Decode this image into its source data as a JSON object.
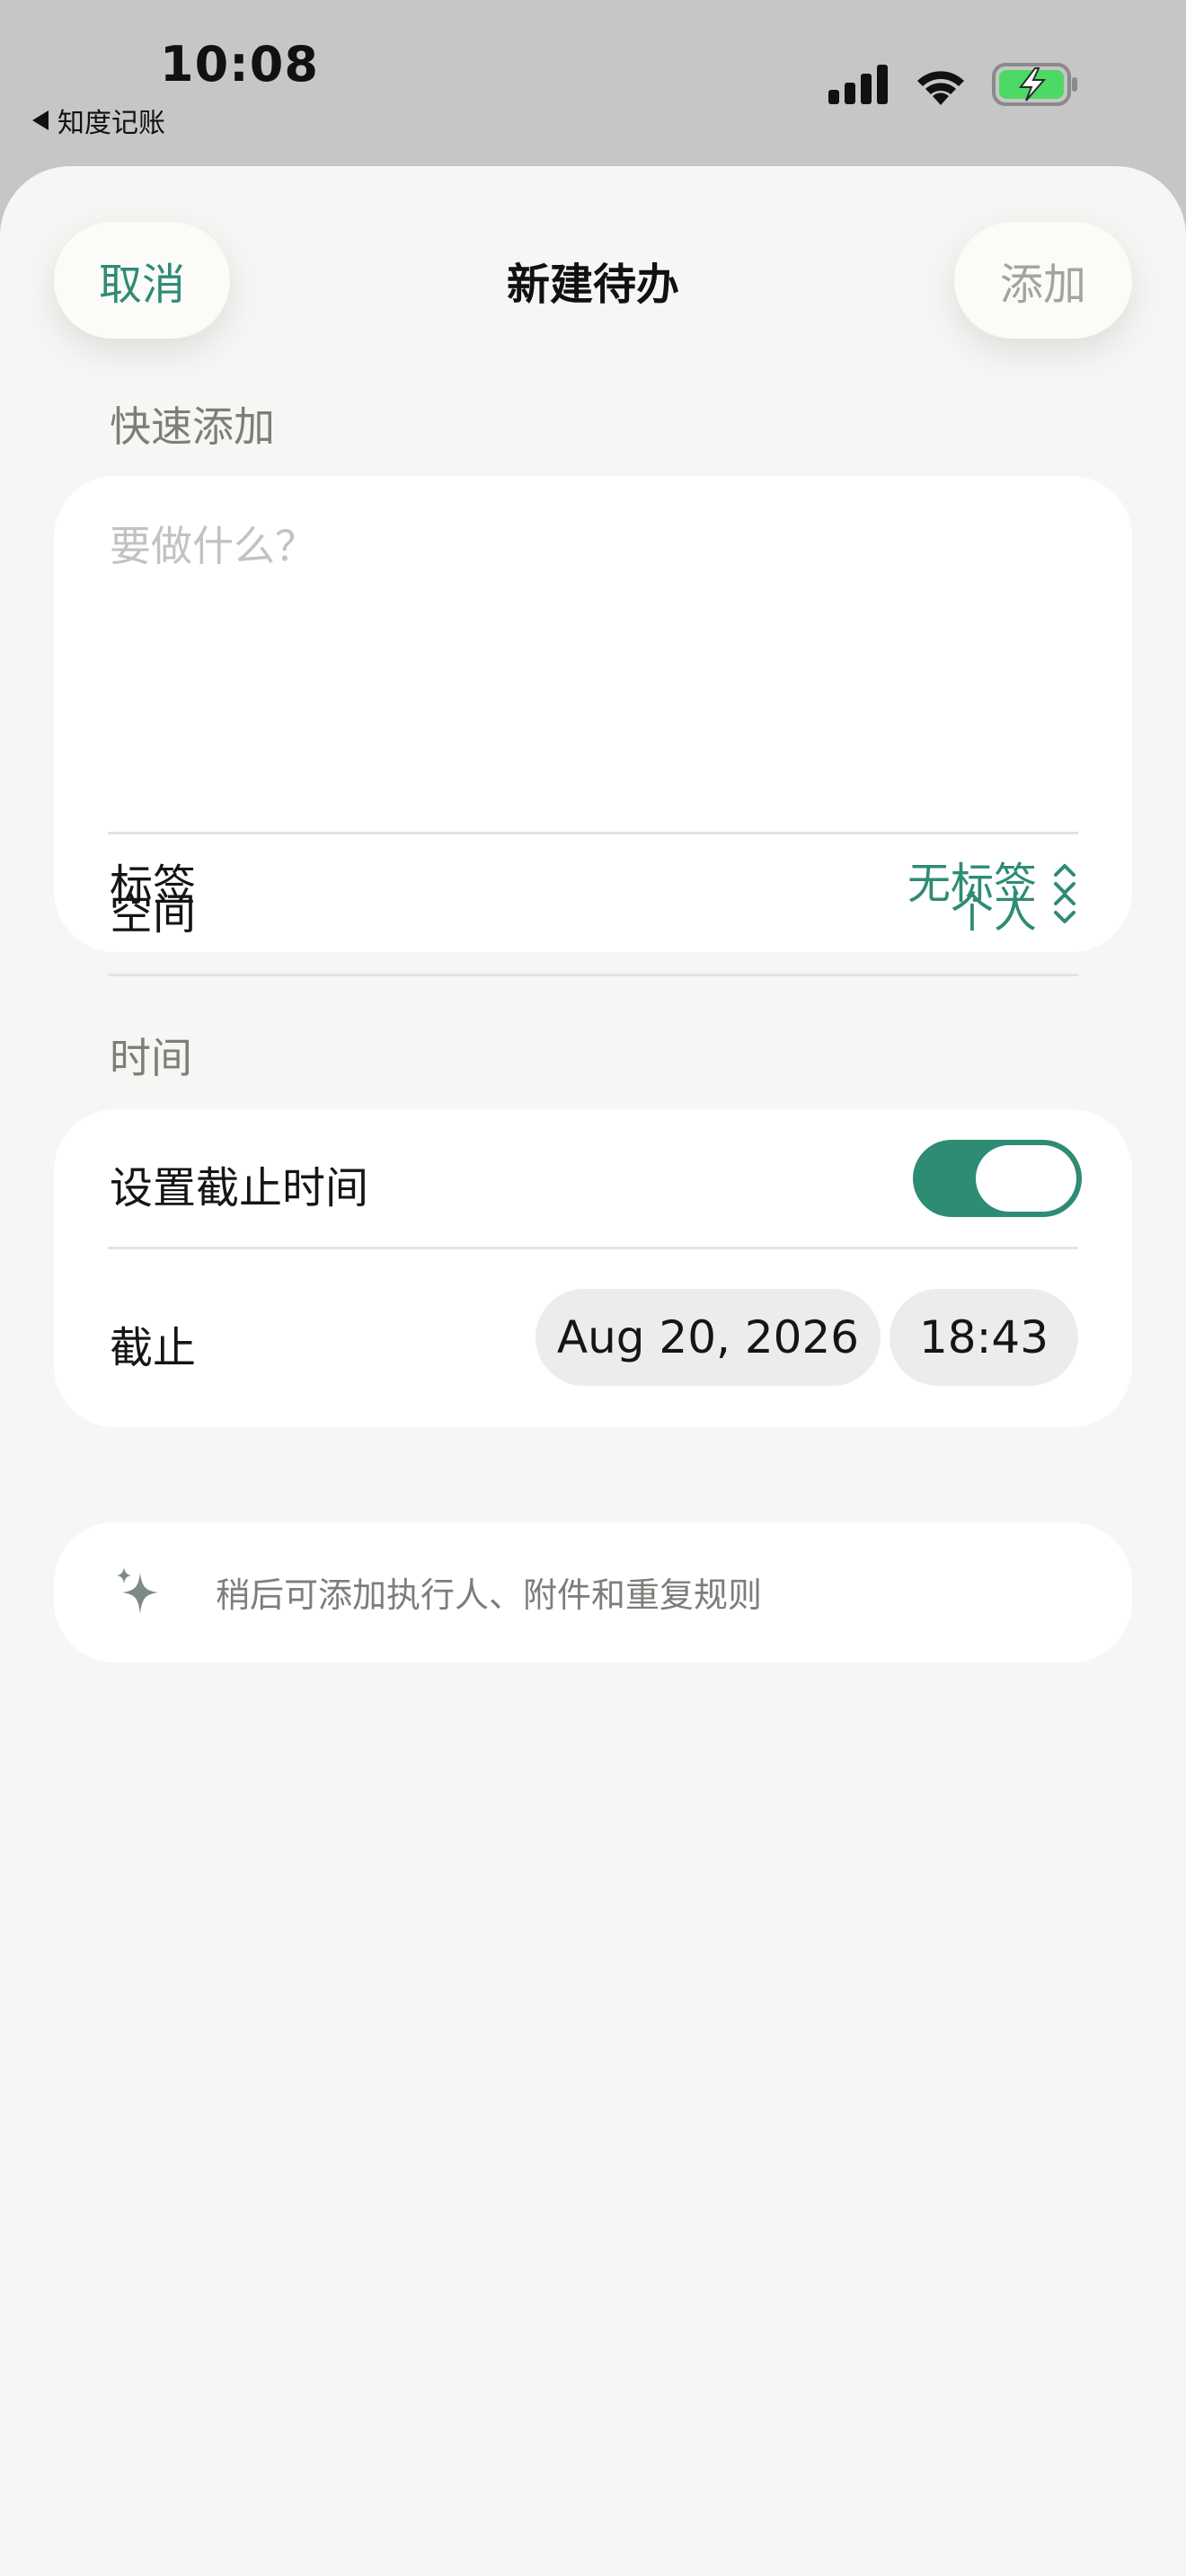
{
  "status_bar": {
    "time": "10:08",
    "back_app": "知度记账"
  },
  "nav": {
    "cancel_label": "取消",
    "title": "新建待办",
    "add_label": "添加"
  },
  "quick_add": {
    "section_label": "快速添加",
    "input_placeholder": "要做什么？",
    "space": {
      "label": "空间",
      "value": "个人"
    },
    "tags": {
      "label": "标签",
      "value": "无标签"
    }
  },
  "time_section": {
    "section_label": "时间",
    "deadline_toggle": {
      "label": "设置截止时间",
      "on": true
    },
    "deadline": {
      "label": "截止",
      "date": "Aug 20, 2026",
      "time": "18:43"
    }
  },
  "hint": {
    "text": "稍后可添加执行人、附件和重复规则",
    "icon": "sparkle-icon"
  },
  "colors": {
    "accent": "#2e8b74",
    "battery_fill": "#4cd964",
    "sheet_background": "#f6f6f4",
    "status_background": "#c6c6c6"
  }
}
